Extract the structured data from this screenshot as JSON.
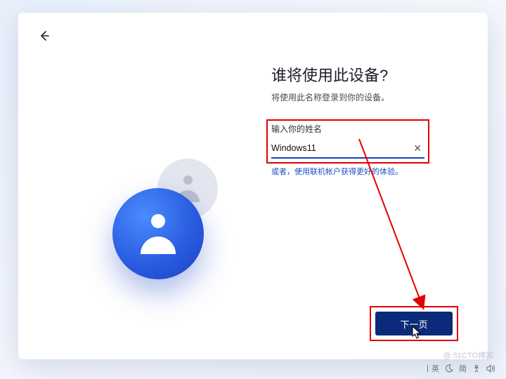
{
  "header": {
    "title": "谁将使用此设备?",
    "subtitle": "将使用此名称登录到你的设备。"
  },
  "form": {
    "field_label": "输入你的姓名",
    "name_value": "Windows11",
    "clear_symbol": "✕",
    "alt_link_text": "或者，使用联机帐户获得更好的体验。"
  },
  "actions": {
    "next_label": "下一页"
  },
  "taskbar": {
    "ime1": "|",
    "ime2": "英",
    "ime3": "简"
  },
  "watermark": "@ 51CTO博客"
}
